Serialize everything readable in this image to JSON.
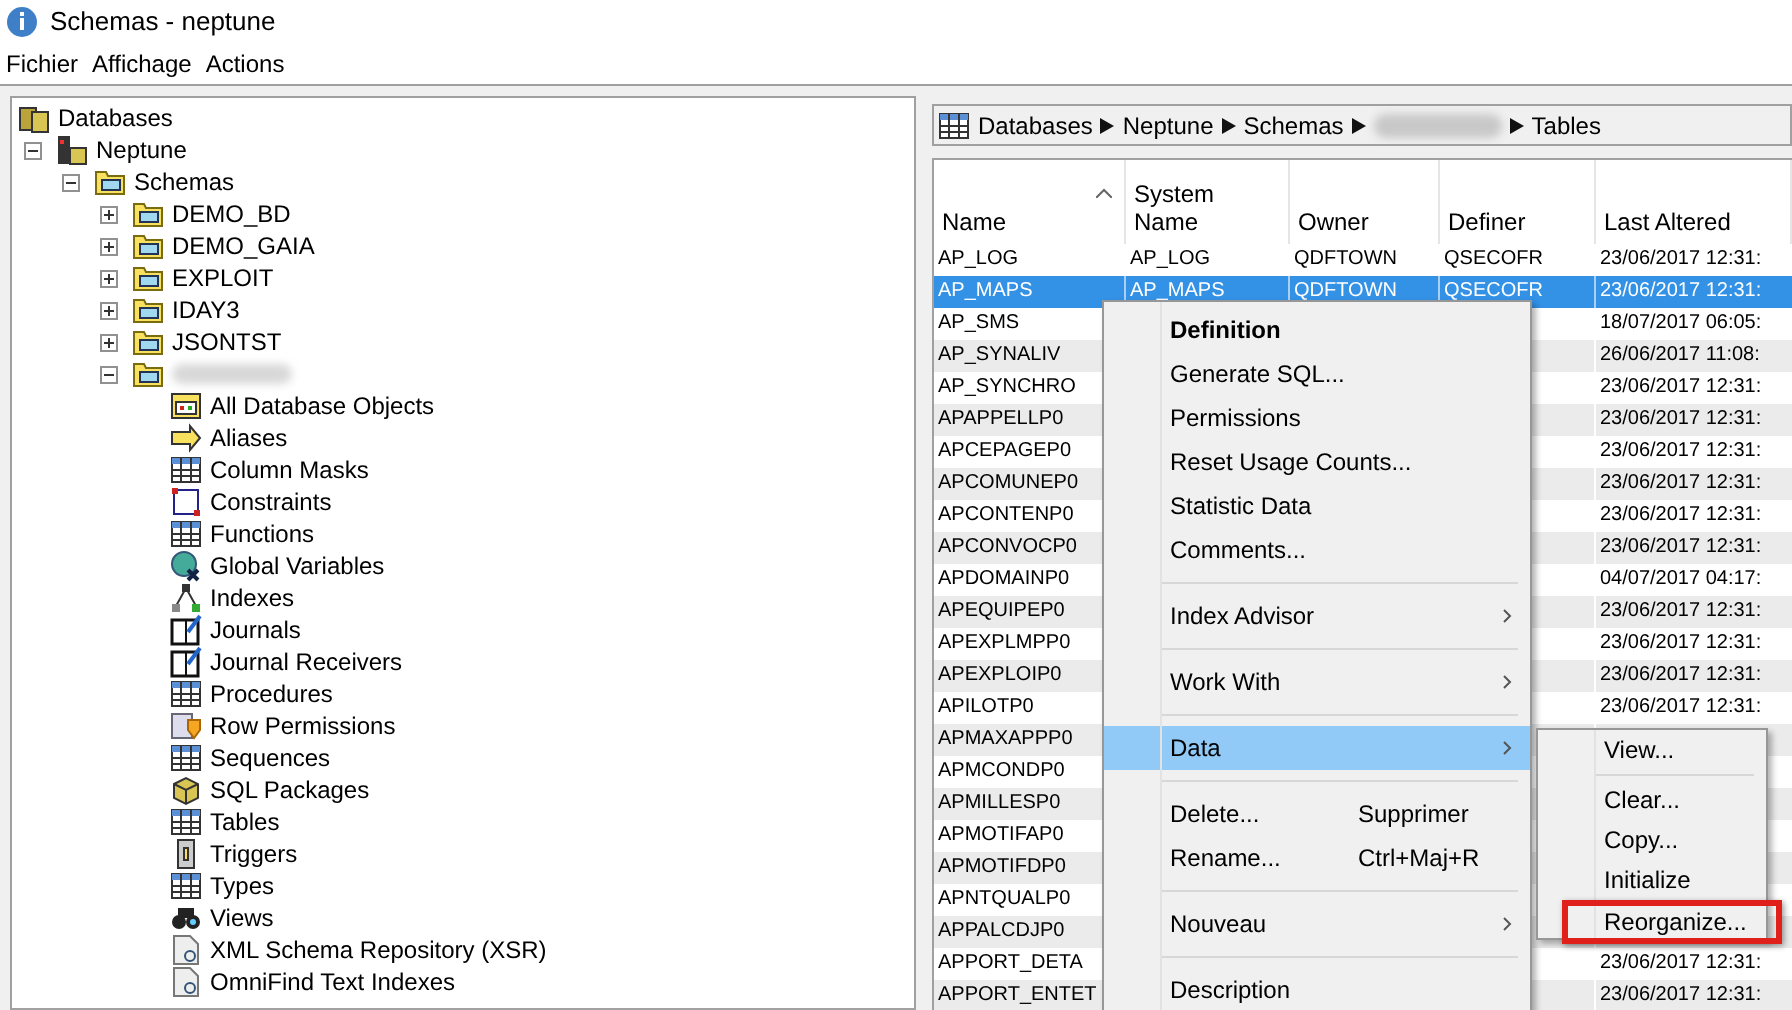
{
  "window": {
    "title": "Schemas - neptune"
  },
  "menu_bar": [
    "Fichier",
    "Affichage",
    "Actions"
  ],
  "tree": {
    "label": "Databases",
    "kind": "databases",
    "children": [
      {
        "label": "Neptune",
        "kind": "system",
        "expanded": true,
        "children": [
          {
            "label": "Schemas",
            "kind": "folder",
            "expanded": true,
            "children": [
              {
                "label": "DEMO_BD",
                "kind": "folder",
                "expanded": false
              },
              {
                "label": "DEMO_GAIA",
                "kind": "folder",
                "expanded": false
              },
              {
                "label": "EXPLOIT",
                "kind": "folder",
                "expanded": false
              },
              {
                "label": "IDAY3",
                "kind": "folder",
                "expanded": false
              },
              {
                "label": "JSONTST",
                "kind": "folder",
                "expanded": false
              },
              {
                "kind": "folder",
                "expanded": true,
                "children": [
                  {
                    "label": "All Database Objects",
                    "kind": "window"
                  },
                  {
                    "label": "Aliases",
                    "kind": "arrow"
                  },
                  {
                    "label": "Column Masks",
                    "kind": "grid"
                  },
                  {
                    "label": "Constraints",
                    "kind": "square"
                  },
                  {
                    "label": "Functions",
                    "kind": "grid"
                  },
                  {
                    "label": "Global Variables",
                    "kind": "globe"
                  },
                  {
                    "label": "Indexes",
                    "kind": "nodes"
                  },
                  {
                    "label": "Journals",
                    "kind": "book"
                  },
                  {
                    "label": "Journal Receivers",
                    "kind": "book"
                  },
                  {
                    "label": "Procedures",
                    "kind": "grid"
                  },
                  {
                    "label": "Row Permissions",
                    "kind": "shield"
                  },
                  {
                    "label": "Sequences",
                    "kind": "grid"
                  },
                  {
                    "label": "SQL Packages",
                    "kind": "box"
                  },
                  {
                    "label": "Tables",
                    "kind": "grid"
                  },
                  {
                    "label": "Triggers",
                    "kind": "switch"
                  },
                  {
                    "label": "Types",
                    "kind": "grid"
                  },
                  {
                    "label": "Views",
                    "kind": "glasses"
                  },
                  {
                    "label": "XML Schema Repository (XSR)",
                    "kind": "document"
                  },
                  {
                    "label": "OmniFind Text Indexes",
                    "kind": "document"
                  }
                ]
              }
            ]
          }
        ]
      }
    ]
  },
  "breadcrumb": [
    {
      "label": "Databases"
    },
    {
      "label": "Neptune"
    },
    {
      "label": "Schemas"
    },
    {
      "kind": "redacted"
    },
    {
      "label": "Tables"
    }
  ],
  "table": {
    "columns": [
      {
        "label": "Name",
        "sorted": true
      },
      {
        "label": "System Name",
        "sorted": false
      },
      {
        "label": "Owner",
        "sorted": false
      },
      {
        "label": "Definer",
        "sorted": false
      },
      {
        "label": "Last Altered",
        "sorted": false
      }
    ],
    "rows": [
      {
        "selected": false,
        "cells": [
          "AP_LOG",
          "AP_LOG",
          "QDFTOWN",
          "QSECOFR",
          "23/06/2017 12:31:"
        ]
      },
      {
        "selected": true,
        "cells": [
          "AP_MAPS",
          "AP_MAPS",
          "QDFTOWN",
          "QSECOFR",
          "23/06/2017 12:31:"
        ]
      },
      {
        "selected": false,
        "cells": [
          "AP_SMS",
          "",
          "",
          "",
          "18/07/2017 06:05:"
        ]
      },
      {
        "selected": false,
        "cells": [
          "AP_SYNALIV",
          "",
          "",
          "",
          "26/06/2017 11:08:"
        ]
      },
      {
        "selected": false,
        "cells": [
          "AP_SYNCHRO",
          "",
          "",
          "",
          "23/06/2017 12:31:"
        ]
      },
      {
        "selected": false,
        "cells": [
          "APAPPELLP0",
          "",
          "",
          "",
          "23/06/2017 12:31:"
        ]
      },
      {
        "selected": false,
        "cells": [
          "APCEPAGEP0",
          "",
          "",
          "",
          "23/06/2017 12:31:"
        ]
      },
      {
        "selected": false,
        "cells": [
          "APCOMUNEP0",
          "",
          "",
          "",
          "23/06/2017 12:31:"
        ]
      },
      {
        "selected": false,
        "cells": [
          "APCONTENP0",
          "",
          "",
          "",
          "23/06/2017 12:31:"
        ]
      },
      {
        "selected": false,
        "cells": [
          "APCONVOCP0",
          "",
          "",
          "",
          "23/06/2017 12:31:"
        ]
      },
      {
        "selected": false,
        "cells": [
          "APDOMAINP0",
          "",
          "",
          "",
          "04/07/2017 04:17:"
        ]
      },
      {
        "selected": false,
        "cells": [
          "APEQUIPEP0",
          "",
          "",
          "",
          "23/06/2017 12:31:"
        ]
      },
      {
        "selected": false,
        "cells": [
          "APEXPLMPP0",
          "",
          "",
          "",
          "23/06/2017 12:31:"
        ]
      },
      {
        "selected": false,
        "cells": [
          "APEXPLOIP0",
          "",
          "",
          "",
          "23/06/2017 12:31:"
        ]
      },
      {
        "selected": false,
        "cells": [
          "APILOTP0",
          "",
          "",
          "",
          "23/06/2017 12:31:"
        ]
      },
      {
        "selected": false,
        "cells": [
          "APMAXAPPP0",
          "",
          "",
          "",
          ""
        ]
      },
      {
        "selected": false,
        "cells": [
          "APMCONDP0",
          "",
          "",
          "",
          ""
        ]
      },
      {
        "selected": false,
        "cells": [
          "APMILLESP0",
          "",
          "",
          "",
          ""
        ]
      },
      {
        "selected": false,
        "cells": [
          "APMOTIFAP0",
          "",
          "",
          "",
          ""
        ]
      },
      {
        "selected": false,
        "cells": [
          "APMOTIFDP0",
          "",
          "",
          "",
          ""
        ]
      },
      {
        "selected": false,
        "cells": [
          "APNTQUALP0",
          "",
          "",
          "",
          ""
        ]
      },
      {
        "selected": false,
        "cells": [
          "APPALCDJP0",
          "",
          "",
          "",
          ""
        ]
      },
      {
        "selected": false,
        "cells": [
          "APPORT_DETA",
          "",
          "",
          "",
          "23/06/2017 12:31:"
        ]
      },
      {
        "selected": false,
        "cells": [
          "APPORT_ENTET",
          "",
          "",
          "",
          "23/06/2017 12:31:"
        ]
      }
    ]
  },
  "context_menu": {
    "items": [
      {
        "kind": "item",
        "label": "Definition",
        "default": true,
        "has_submenu": false,
        "selected": false
      },
      {
        "kind": "item",
        "label": "Generate SQL...",
        "default": false,
        "has_submenu": false,
        "selected": false
      },
      {
        "kind": "item",
        "label": "Permissions",
        "default": false,
        "has_submenu": false,
        "selected": false
      },
      {
        "kind": "item",
        "label": "Reset Usage Counts...",
        "default": false,
        "has_submenu": false,
        "selected": false
      },
      {
        "kind": "item",
        "label": "Statistic Data",
        "default": false,
        "has_submenu": false,
        "selected": false
      },
      {
        "kind": "item",
        "label": "Comments...",
        "default": false,
        "has_submenu": false,
        "selected": false
      },
      {
        "kind": "separator"
      },
      {
        "kind": "item",
        "label": "Index Advisor",
        "default": false,
        "has_submenu": true,
        "selected": false
      },
      {
        "kind": "separator"
      },
      {
        "kind": "item",
        "label": "Work With",
        "default": false,
        "has_submenu": true,
        "selected": false
      },
      {
        "kind": "separator"
      },
      {
        "kind": "item",
        "label": "Data",
        "default": false,
        "has_submenu": true,
        "selected": true
      },
      {
        "kind": "separator"
      },
      {
        "kind": "item",
        "label": "Delete...",
        "shortcut": "Supprimer",
        "default": false,
        "has_submenu": false,
        "selected": false
      },
      {
        "kind": "item",
        "label": "Rename...",
        "shortcut": "Ctrl+Maj+R",
        "default": false,
        "has_submenu": false,
        "selected": false
      },
      {
        "kind": "separator"
      },
      {
        "kind": "item",
        "label": "Nouveau",
        "default": false,
        "has_submenu": true,
        "selected": false
      },
      {
        "kind": "separator"
      },
      {
        "kind": "item",
        "label": "Description",
        "default": false,
        "has_submenu": false,
        "selected": false
      }
    ]
  },
  "submenu": {
    "items": [
      {
        "kind": "item",
        "label": "View...",
        "annotated": false
      },
      {
        "kind": "separator"
      },
      {
        "kind": "item",
        "label": "Clear...",
        "annotated": false
      },
      {
        "kind": "item",
        "label": "Copy...",
        "annotated": false
      },
      {
        "kind": "item",
        "label": "Initialize",
        "annotated": false
      },
      {
        "kind": "item",
        "label": "Reorganize...",
        "annotated": true
      }
    ]
  }
}
